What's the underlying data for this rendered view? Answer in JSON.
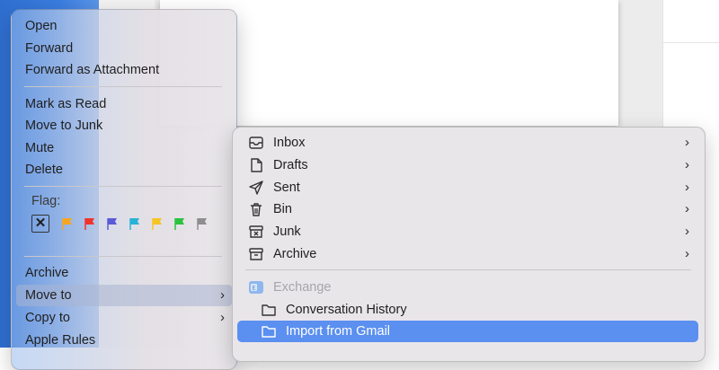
{
  "context_menu": {
    "items_top": [
      {
        "label": "Open"
      },
      {
        "label": "Forward"
      },
      {
        "label": "Forward as Attachment"
      }
    ],
    "items_mid": [
      {
        "label": "Mark as Read"
      },
      {
        "label": "Move to Junk"
      },
      {
        "label": "Mute"
      },
      {
        "label": "Delete"
      }
    ],
    "flag": {
      "label": "Flag:",
      "clear_symbol": "✕",
      "colors": [
        "#f6a623",
        "#f0342b",
        "#5a5ad8",
        "#2ab2d6",
        "#f5c526",
        "#2bc23f",
        "#8e8e8e"
      ]
    },
    "items_bottom": [
      {
        "label": "Archive"
      },
      {
        "label": "Move to",
        "highlighted": true
      },
      {
        "label": "Copy to"
      },
      {
        "label": "Apple Rules"
      }
    ],
    "chevron": "›"
  },
  "submenu": {
    "mailboxes": [
      {
        "label": "Inbox",
        "icon": "inbox-icon"
      },
      {
        "label": "Drafts",
        "icon": "document-icon"
      },
      {
        "label": "Sent",
        "icon": "paper-plane-icon"
      },
      {
        "label": "Bin",
        "icon": "trash-icon"
      },
      {
        "label": "Junk",
        "icon": "junk-icon"
      },
      {
        "label": "Archive",
        "icon": "archive-box-icon"
      }
    ],
    "account": {
      "label": "Exchange",
      "icon": "exchange-icon"
    },
    "folders": [
      {
        "label": "Conversation History",
        "icon": "folder-icon"
      },
      {
        "label": "Import from Gmail",
        "icon": "folder-icon",
        "highlighted": true
      }
    ],
    "chevron": "›"
  }
}
